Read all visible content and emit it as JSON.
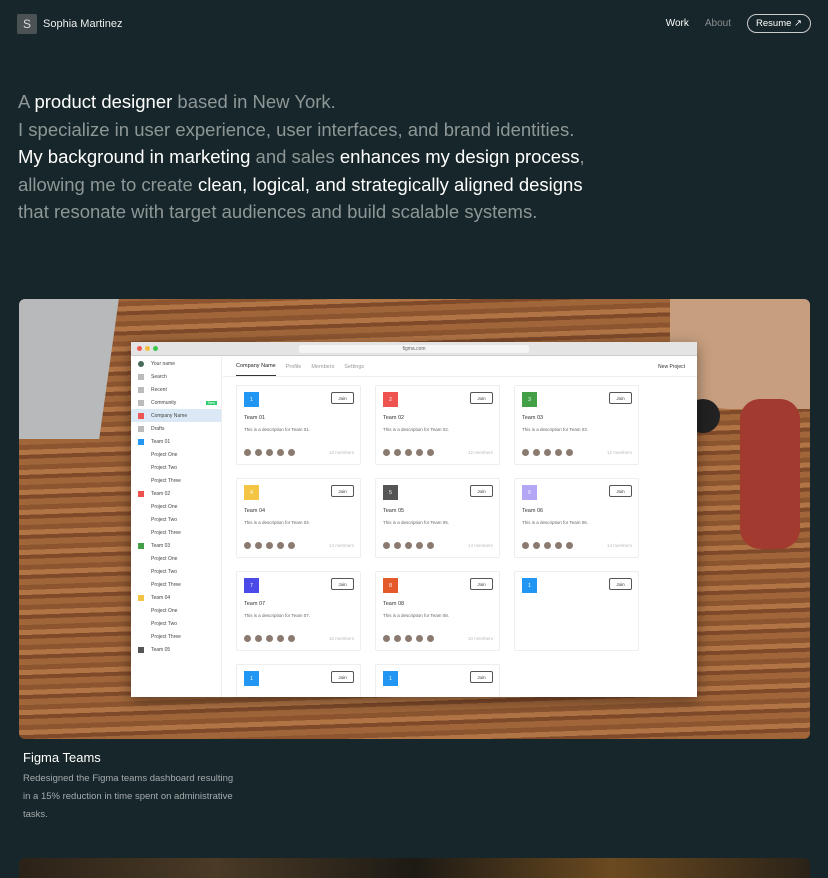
{
  "nav": {
    "logo_letter": "S",
    "name": "Sophia Martinez",
    "work": "Work",
    "about": "About",
    "resume": "Resume ↗"
  },
  "hero": {
    "segments": [
      [
        "A ",
        0
      ],
      [
        "product designer",
        1
      ],
      [
        " based in New York.",
        0
      ],
      [
        "\n",
        0
      ],
      [
        "I specialize in user experience, user interfaces, and brand identities.",
        0
      ],
      [
        "\n",
        0
      ],
      [
        "My background in marketing",
        1
      ],
      [
        " and sales ",
        0
      ],
      [
        "enhances my design process",
        1
      ],
      [
        ",",
        0
      ],
      [
        "\n",
        0
      ],
      [
        "allowing me to create ",
        0
      ],
      [
        "clean, logical, and strategically aligned designs",
        1
      ],
      [
        "\n",
        0
      ],
      [
        "that resonate with target audiences and build scalable systems.",
        0
      ]
    ]
  },
  "mock": {
    "url": "figma.com",
    "user": "Your name",
    "menu": [
      "Search",
      "Recent",
      "Community"
    ],
    "new_badge": "New",
    "company": "Company Name",
    "drafts": "Drafts",
    "sidebar_teams": [
      {
        "name": "Team 01",
        "color": "#2196f3"
      },
      {
        "name": "Team 02",
        "color": "#ef5350"
      },
      {
        "name": "Team 03",
        "color": "#43a047"
      },
      {
        "name": "Team 04",
        "color": "#f4c542"
      },
      {
        "name": "Team 05",
        "color": "#555555"
      }
    ],
    "projects": [
      "Project One",
      "Project Two",
      "Project Three"
    ],
    "tabs": [
      "Company Name",
      "Profile",
      "Members",
      "Settings"
    ],
    "new_project": "New Project",
    "join": "Join",
    "teams": [
      {
        "n": "1",
        "name": "Team 01",
        "desc": "This is a description for Team 01.",
        "members": "12 members",
        "color": "#2196f3"
      },
      {
        "n": "2",
        "name": "Team 02",
        "desc": "This is a description for Team 02.",
        "members": "12 members",
        "color": "#ef5350"
      },
      {
        "n": "3",
        "name": "Team 03",
        "desc": "This is a description for Team 03.",
        "members": "12 members",
        "color": "#43a047"
      },
      {
        "n": "4",
        "name": "Team 04",
        "desc": "This is a description for Team 04.",
        "members": "14 members",
        "color": "#f4c542"
      },
      {
        "n": "5",
        "name": "Team 05",
        "desc": "This is a description for Team 05.",
        "members": "14 members",
        "color": "#555555"
      },
      {
        "n": "6",
        "name": "Team 06",
        "desc": "This is a description for Team 06.",
        "members": "14 members",
        "color": "#b3a6f5"
      },
      {
        "n": "7",
        "name": "Team 07",
        "desc": "This is a description for Team 07.",
        "members": "10 members",
        "color": "#4a4ae8"
      },
      {
        "n": "8",
        "name": "Team 08",
        "desc": "This is a description for Team 08.",
        "members": "10 members",
        "color": "#e55a2b"
      },
      {
        "n": "1",
        "name": "",
        "desc": "",
        "members": "",
        "color": "#2196f3"
      },
      {
        "n": "1",
        "name": "",
        "desc": "",
        "members": "",
        "color": "#2196f3"
      },
      {
        "n": "1",
        "name": "",
        "desc": "",
        "members": "",
        "color": "#2196f3"
      }
    ]
  },
  "project": {
    "title": "Figma Teams",
    "description": "Redesigned the Figma teams dashboard resulting in a 15% reduction in time spent on administrative tasks."
  }
}
